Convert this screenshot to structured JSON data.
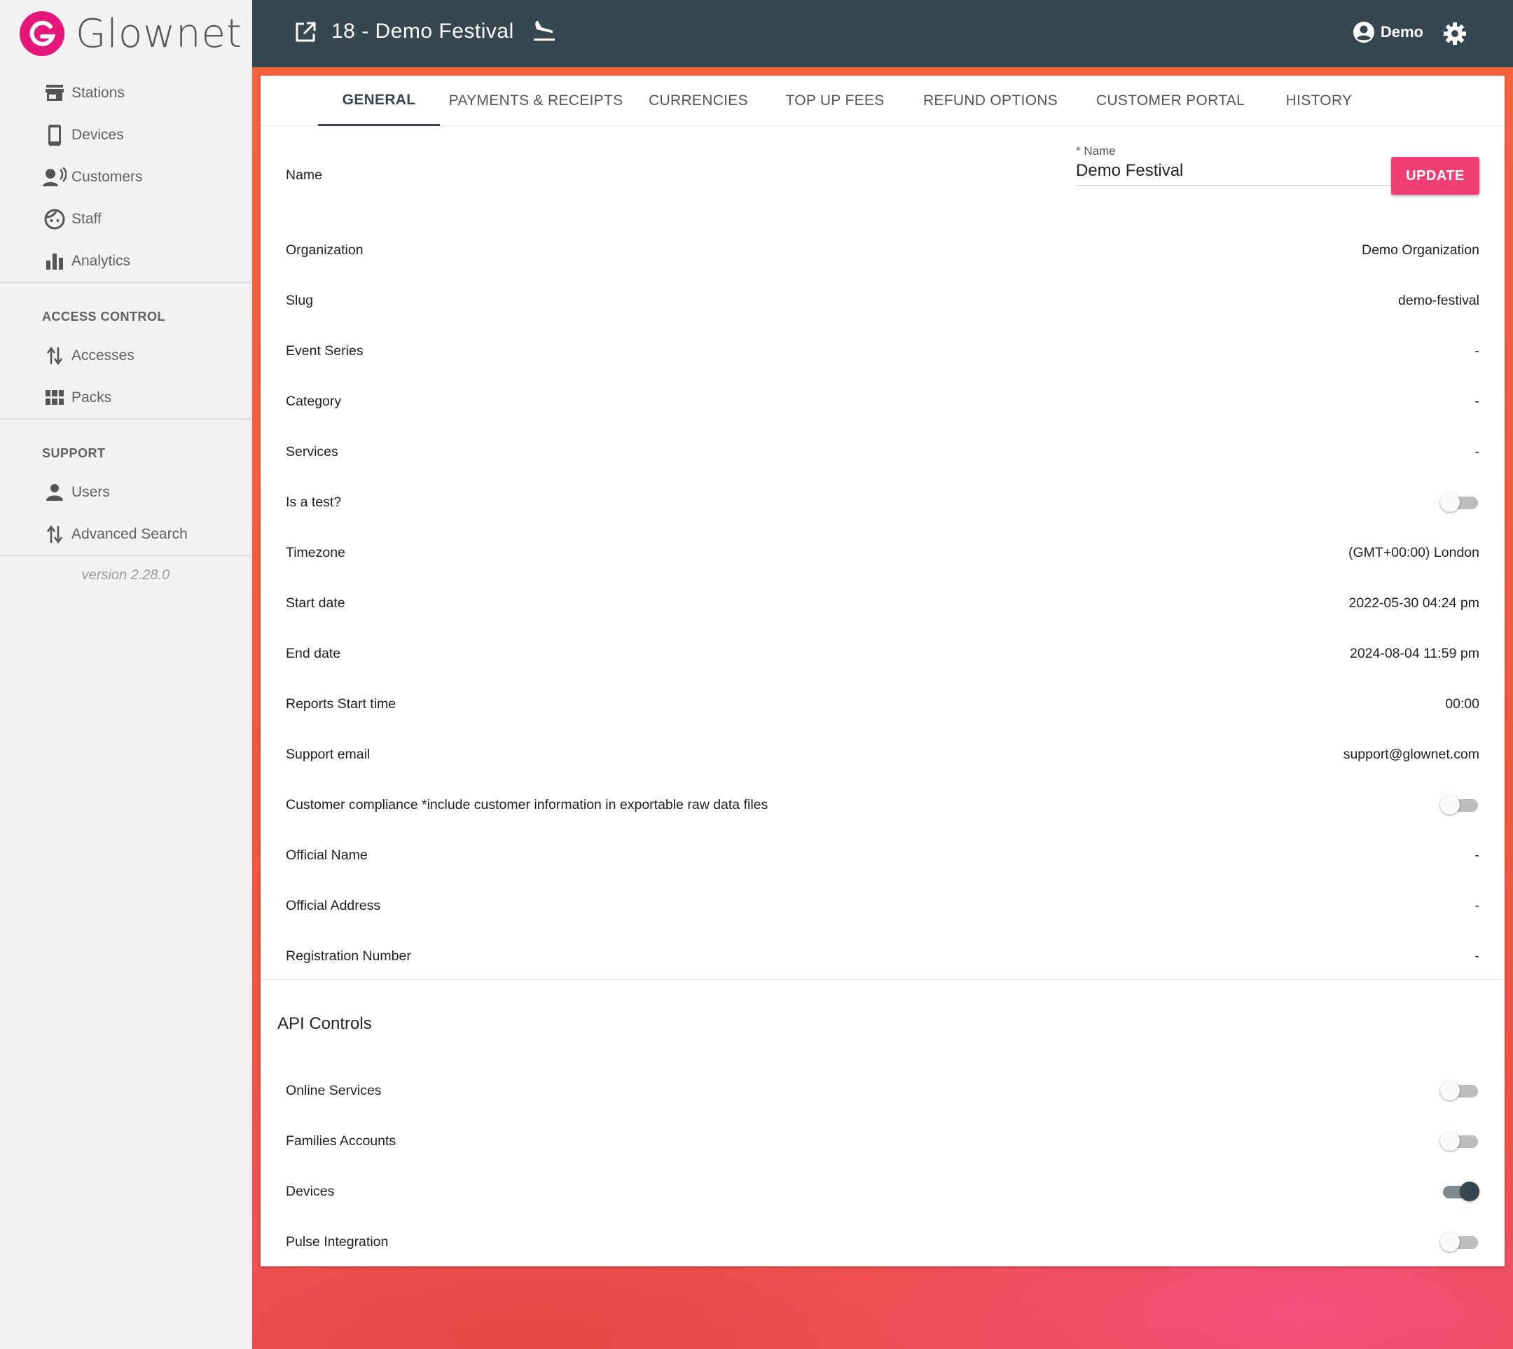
{
  "brand": {
    "name": "Glownet",
    "accent": "#e6177a"
  },
  "sidebar": {
    "items": [
      {
        "label": "Stations",
        "icon": "store-icon"
      },
      {
        "label": "Devices",
        "icon": "smartphone-icon"
      },
      {
        "label": "Customers",
        "icon": "record-voice-icon"
      },
      {
        "label": "Staff",
        "icon": "face-icon"
      },
      {
        "label": "Analytics",
        "icon": "bar-chart-icon"
      }
    ],
    "access_control": {
      "heading": "ACCESS CONTROL",
      "items": [
        {
          "label": "Accesses",
          "icon": "swap-vert-icon"
        },
        {
          "label": "Packs",
          "icon": "grid-icon"
        }
      ]
    },
    "support": {
      "heading": "SUPPORT",
      "items": [
        {
          "label": "Users",
          "icon": "person-icon"
        },
        {
          "label": "Advanced Search",
          "icon": "swap-vert-icon"
        }
      ]
    },
    "version": "version 2.28.0"
  },
  "header": {
    "title": "18 - Demo Festival",
    "user": "Demo",
    "bg_color": "#37474f"
  },
  "tabs": [
    {
      "label": "GENERAL",
      "active": true
    },
    {
      "label": "PAYMENTS & RECEIPTS",
      "active": false
    },
    {
      "label": "CURRENCIES",
      "active": false
    },
    {
      "label": "TOP UP FEES",
      "active": false
    },
    {
      "label": "REFUND OPTIONS",
      "active": false
    },
    {
      "label": "CUSTOMER PORTAL",
      "active": false
    },
    {
      "label": "HISTORY",
      "active": false
    }
  ],
  "general": {
    "name_row": {
      "label": "Name",
      "field_label": "* Name",
      "field_value": "Demo Festival",
      "update_label": "UPDATE",
      "button_color": "#ef3f74"
    },
    "rows": [
      {
        "label": "Organization",
        "value": "Demo Organization"
      },
      {
        "label": "Slug",
        "value": "demo-festival"
      },
      {
        "label": "Event Series",
        "value": "-"
      },
      {
        "label": "Category",
        "value": "-"
      },
      {
        "label": "Services",
        "value": "-"
      },
      {
        "label": "Is a test?",
        "toggle": false
      },
      {
        "label": "Timezone",
        "value": "(GMT+00:00) London"
      },
      {
        "label": "Start date",
        "value": "2022-05-30 04:24 pm"
      },
      {
        "label": "End date",
        "value": "2024-08-04 11:59 pm"
      },
      {
        "label": "Reports Start time",
        "value": "00:00"
      },
      {
        "label": "Support email",
        "value": "support@glownet.com"
      },
      {
        "label": "Customer compliance *include customer information in exportable raw data files",
        "toggle": false
      },
      {
        "label": "Official Name",
        "value": "-"
      },
      {
        "label": "Official Address",
        "value": "-"
      },
      {
        "label": "Registration Number",
        "value": "-"
      }
    ]
  },
  "api_controls": {
    "title": "API Controls",
    "rows": [
      {
        "label": "Online Services",
        "toggle": false
      },
      {
        "label": "Families Accounts",
        "toggle": false
      },
      {
        "label": "Devices",
        "toggle": true
      },
      {
        "label": "Pulse Integration",
        "toggle": false
      }
    ]
  }
}
